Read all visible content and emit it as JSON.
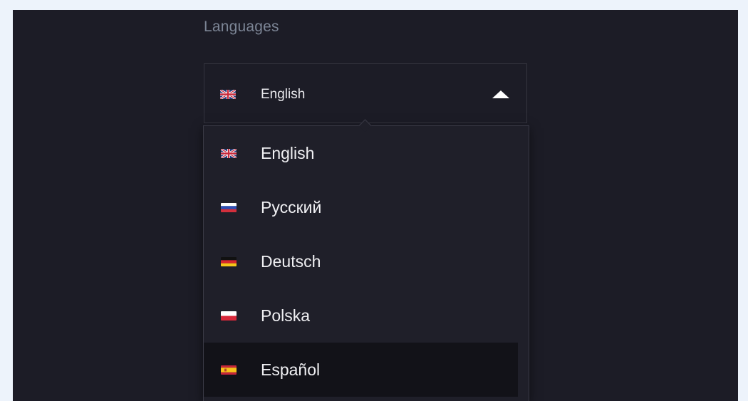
{
  "section": {
    "title": "Languages"
  },
  "select": {
    "current_label": "English",
    "current_flag": "uk-flag-icon",
    "expanded": true
  },
  "options": [
    {
      "label": "English",
      "flag": "uk-flag-icon",
      "highlighted": false
    },
    {
      "label": "Русский",
      "flag": "russia-flag-icon",
      "highlighted": false
    },
    {
      "label": "Deutsch",
      "flag": "germany-flag-icon",
      "highlighted": false
    },
    {
      "label": "Polska",
      "flag": "poland-flag-icon",
      "highlighted": false
    },
    {
      "label": "Español",
      "flag": "spain-flag-icon",
      "highlighted": true
    }
  ],
  "colors": {
    "background": "#1c1c26",
    "dropdown_background": "#1f1f29",
    "highlight_background": "#121218",
    "muted_text": "#7c8595",
    "text": "#f0f0f3"
  }
}
